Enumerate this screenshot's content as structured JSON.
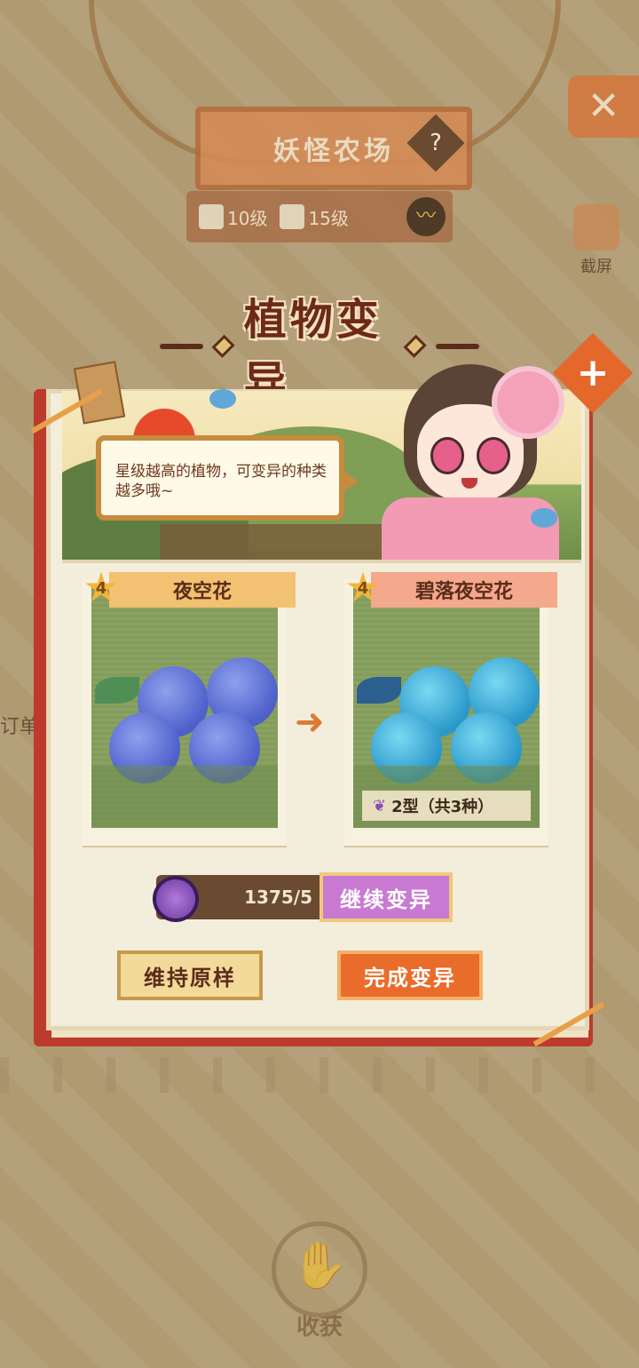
{
  "background": {
    "farm_title": "妖怪农场",
    "help_icon": "?",
    "levels": [
      {
        "icon": "cow-icon",
        "label": "10级"
      },
      {
        "icon": "ghost-icon",
        "label": "15级"
      }
    ],
    "close_label": "✕",
    "screenshot_label": "截屏",
    "side_label": "订单",
    "harvest_label": "收获"
  },
  "panel": {
    "title": "植物变异",
    "speech": "星级越高的植物，可变异的种类越多哦~",
    "plus_label": "+",
    "source_card": {
      "stars": "4",
      "name": "夜空花"
    },
    "target_card": {
      "stars": "4",
      "name": "碧落夜空花",
      "variant": "2型（共3种）"
    },
    "arrow": "➜",
    "counter": "1375/5",
    "continue_button": "继续变异",
    "keep_button": "维持原样",
    "finish_button": "完成变异"
  },
  "colors": {
    "panel_red": "#bd3b2c",
    "accent_orange": "#ea6c2a",
    "purple_button": "#c87ad2",
    "title_brown": "#6e2a17"
  }
}
